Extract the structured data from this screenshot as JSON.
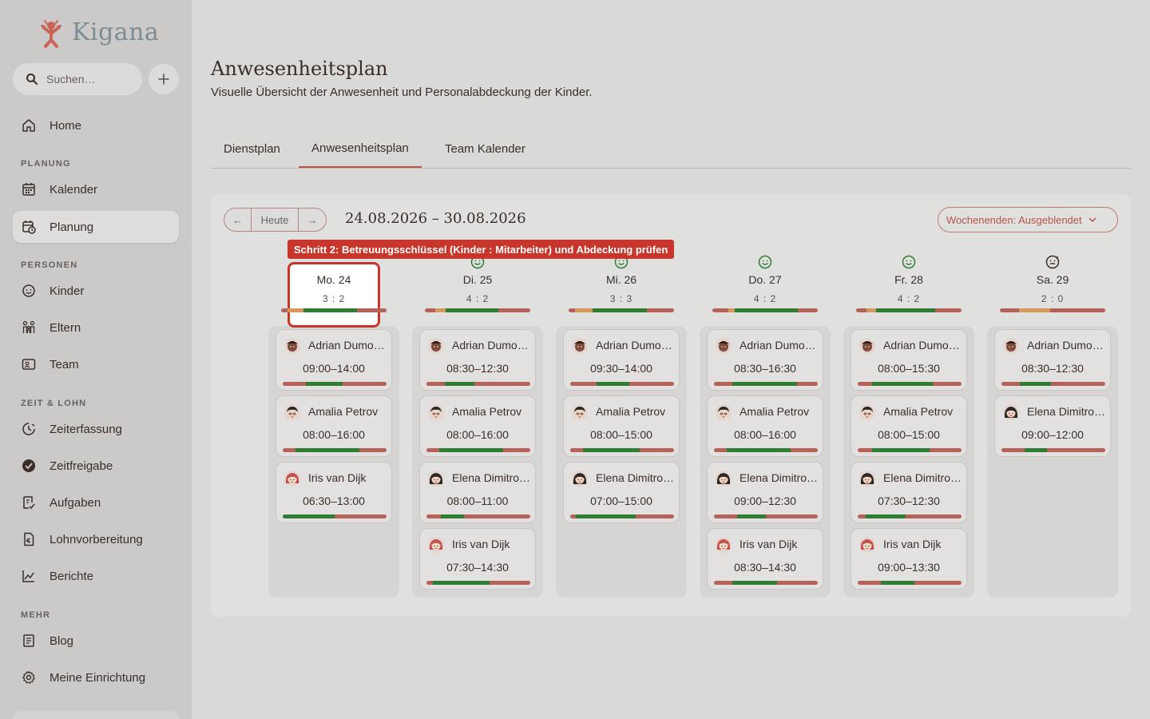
{
  "app": {
    "name": "Kigana"
  },
  "search": {
    "placeholder": "Suchen…"
  },
  "nav": {
    "home": "Home",
    "sec_planung": "PLANUNG",
    "kalender": "Kalender",
    "planung": "Planung",
    "sec_personen": "PERSONEN",
    "kinder": "Kinder",
    "eltern": "Eltern",
    "team": "Team",
    "sec_zeit": "ZEIT & LOHN",
    "zeiterfassung": "Zeiterfassung",
    "zeitfreigabe": "Zeitfreigabe",
    "aufgaben": "Aufgaben",
    "lohnvorbereitung": "Lohnvorbereitung",
    "berichte": "Berichte",
    "sec_mehr": "MEHR",
    "blog": "Blog",
    "einrichtung": "Meine Einrichtung"
  },
  "page": {
    "title": "Anwesenheitsplan",
    "subtitle": "Visuelle Übersicht der Anwesenheit und Personalabdeckung der Kinder."
  },
  "tabs": [
    "Dienstplan",
    "Anwesenheitsplan",
    "Team Kalender"
  ],
  "toolbar": {
    "prev": "←",
    "today": "Heute",
    "next": "→",
    "range": "24.08.2026 – 30.08.2026",
    "weekends": "Wochenenden: Ausgeblendet"
  },
  "tooltip": "Schritt 2: Betreuungsschlüssel (Kinder : Mitarbeiter) und Abdeckung prüfen",
  "colors": {
    "good": "#2e7d32",
    "warn": "#d89a5a",
    "bad": "#b5625a",
    "accent": "#c8352b"
  },
  "days": [
    {
      "label": "Mo. 24",
      "ratio": "3 : 2",
      "face": "smile",
      "coverage": [
        [
          "bad",
          0.06
        ],
        [
          "warn",
          0.15
        ],
        [
          "good",
          0.51
        ],
        [
          "bad",
          0.28
        ]
      ],
      "kids": [
        {
          "name": "Adrian Dumo…",
          "time": "09:00–14:00",
          "avatar": "adrian",
          "bar": [
            [
              "bad",
              0.22
            ],
            [
              "good",
              0.36
            ],
            [
              "bad",
              0.42
            ]
          ]
        },
        {
          "name": "Amalia Petrov",
          "time": "08:00–16:00",
          "avatar": "amalia",
          "bar": [
            [
              "bad",
              0.12
            ],
            [
              "good",
              0.62
            ],
            [
              "bad",
              0.26
            ]
          ]
        },
        {
          "name": "Iris van Dijk",
          "time": "06:30–13:00",
          "avatar": "iris",
          "bar": [
            [
              "good",
              0.5
            ],
            [
              "bad",
              0.5
            ]
          ]
        }
      ]
    },
    {
      "label": "Di. 25",
      "ratio": "4 : 2",
      "face": "smile",
      "coverage": [
        [
          "bad",
          0.1
        ],
        [
          "warn",
          0.1
        ],
        [
          "good",
          0.5
        ],
        [
          "bad",
          0.3
        ]
      ],
      "kids": [
        {
          "name": "Adrian Dumo…",
          "time": "08:30–12:30",
          "avatar": "adrian",
          "bar": [
            [
              "bad",
              0.18
            ],
            [
              "good",
              0.28
            ],
            [
              "bad",
              0.54
            ]
          ]
        },
        {
          "name": "Amalia Petrov",
          "time": "08:00–16:00",
          "avatar": "amalia",
          "bar": [
            [
              "bad",
              0.12
            ],
            [
              "good",
              0.62
            ],
            [
              "bad",
              0.26
            ]
          ]
        },
        {
          "name": "Elena Dimitro…",
          "time": "08:00–11:00",
          "avatar": "elena",
          "bar": [
            [
              "bad",
              0.14
            ],
            [
              "good",
              0.22
            ],
            [
              "bad",
              0.64
            ]
          ]
        },
        {
          "name": "Iris van Dijk",
          "time": "07:30–14:30",
          "avatar": "iris",
          "bar": [
            [
              "bad",
              0.06
            ],
            [
              "good",
              0.55
            ],
            [
              "bad",
              0.39
            ]
          ]
        }
      ]
    },
    {
      "label": "Mi. 26",
      "ratio": "3 : 3",
      "face": "smile",
      "coverage": [
        [
          "bad",
          0.06
        ],
        [
          "warn",
          0.17
        ],
        [
          "good",
          0.51
        ],
        [
          "bad",
          0.26
        ]
      ],
      "kids": [
        {
          "name": "Adrian Dumo…",
          "time": "09:30–14:00",
          "avatar": "adrian",
          "bar": [
            [
              "bad",
              0.25
            ],
            [
              "good",
              0.32
            ],
            [
              "bad",
              0.43
            ]
          ]
        },
        {
          "name": "Amalia Petrov",
          "time": "08:00–15:00",
          "avatar": "amalia",
          "bar": [
            [
              "bad",
              0.12
            ],
            [
              "good",
              0.55
            ],
            [
              "bad",
              0.33
            ]
          ]
        },
        {
          "name": "Elena Dimitro…",
          "time": "07:00–15:00",
          "avatar": "elena",
          "bar": [
            [
              "bad",
              0.05
            ],
            [
              "good",
              0.58
            ],
            [
              "bad",
              0.37
            ]
          ]
        }
      ]
    },
    {
      "label": "Do. 27",
      "ratio": "4 : 2",
      "face": "smile",
      "coverage": [
        [
          "bad",
          0.15
        ],
        [
          "warn",
          0.06
        ],
        [
          "good",
          0.6
        ],
        [
          "bad",
          0.19
        ]
      ],
      "kids": [
        {
          "name": "Adrian Dumo…",
          "time": "08:30–16:30",
          "avatar": "adrian",
          "bar": [
            [
              "bad",
              0.18
            ],
            [
              "good",
              0.62
            ],
            [
              "bad",
              0.2
            ]
          ]
        },
        {
          "name": "Amalia Petrov",
          "time": "08:00–16:00",
          "avatar": "amalia",
          "bar": [
            [
              "bad",
              0.12
            ],
            [
              "good",
              0.62
            ],
            [
              "bad",
              0.26
            ]
          ]
        },
        {
          "name": "Elena Dimitro…",
          "time": "09:00–12:30",
          "avatar": "elena",
          "bar": [
            [
              "bad",
              0.22
            ],
            [
              "good",
              0.28
            ],
            [
              "bad",
              0.5
            ]
          ]
        },
        {
          "name": "Iris van Dijk",
          "time": "08:30–14:30",
          "avatar": "iris",
          "bar": [
            [
              "bad",
              0.18
            ],
            [
              "good",
              0.43
            ],
            [
              "bad",
              0.39
            ]
          ]
        }
      ]
    },
    {
      "label": "Fr. 28",
      "ratio": "4 : 2",
      "face": "smile",
      "coverage": [
        [
          "bad",
          0.1
        ],
        [
          "warn",
          0.09
        ],
        [
          "good",
          0.56
        ],
        [
          "bad",
          0.25
        ]
      ],
      "kids": [
        {
          "name": "Adrian Dumo…",
          "time": "08:00–15:30",
          "avatar": "adrian",
          "bar": [
            [
              "bad",
              0.14
            ],
            [
              "good",
              0.58
            ],
            [
              "bad",
              0.28
            ]
          ]
        },
        {
          "name": "Amalia Petrov",
          "time": "08:00–15:00",
          "avatar": "amalia",
          "bar": [
            [
              "bad",
              0.14
            ],
            [
              "good",
              0.55
            ],
            [
              "bad",
              0.31
            ]
          ]
        },
        {
          "name": "Elena Dimitro…",
          "time": "07:30–12:30",
          "avatar": "elena",
          "bar": [
            [
              "bad",
              0.08
            ],
            [
              "good",
              0.38
            ],
            [
              "bad",
              0.54
            ]
          ]
        },
        {
          "name": "Iris van Dijk",
          "time": "09:00–13:30",
          "avatar": "iris",
          "bar": [
            [
              "bad",
              0.22
            ],
            [
              "good",
              0.33
            ],
            [
              "bad",
              0.45
            ]
          ]
        }
      ]
    },
    {
      "label": "Sa. 29",
      "ratio": "2 : 0",
      "face": "neutral",
      "coverage": [
        [
          "bad",
          0.18
        ],
        [
          "warn",
          0.3
        ],
        [
          "bad",
          0.52
        ]
      ],
      "kids": [
        {
          "name": "Adrian Dumo…",
          "time": "08:30–12:30",
          "avatar": "adrian",
          "bar": [
            [
              "bad",
              0.18
            ],
            [
              "good",
              0.3
            ],
            [
              "bad",
              0.52
            ]
          ]
        },
        {
          "name": "Elena Dimitro…",
          "time": "09:00–12:00",
          "avatar": "elena",
          "bar": [
            [
              "bad",
              0.22
            ],
            [
              "good",
              0.22
            ],
            [
              "bad",
              0.56
            ]
          ]
        }
      ]
    }
  ]
}
